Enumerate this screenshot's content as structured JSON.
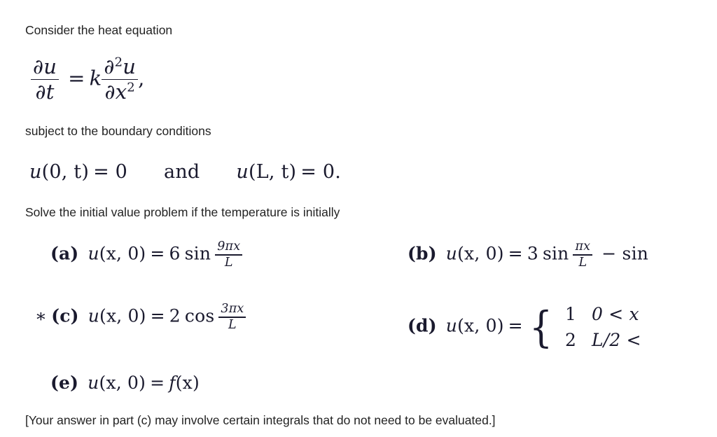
{
  "document": {
    "type": "math-textbook-problem",
    "background_color": "#ffffff",
    "prose_color": "#232323",
    "math_color": "#1a1a2e",
    "truncated_right_edge": true
  },
  "intro": {
    "line": "Consider the heat equation"
  },
  "pde": {
    "lhs_numerator": "∂u",
    "lhs_denominator": "∂t",
    "equals": "=",
    "coefficient": "k",
    "rhs_numerator_partial": "∂",
    "rhs_numerator_exponent": "2",
    "rhs_numerator_var": "u",
    "rhs_denominator_partial": "∂",
    "rhs_denominator_var": "x",
    "rhs_denominator_exponent": "2",
    "trailing_punctuation": ","
  },
  "boundary": {
    "lead_in": "subject to the boundary conditions",
    "left_condition": "u(0, t) = 0",
    "left_fn": "u",
    "left_args": "(0, t)",
    "left_eq": "= 0",
    "conjunction": "and",
    "right_fn": "u",
    "right_args": "(L, t)",
    "right_eq": "= 0."
  },
  "solve_line": "Solve the initial value problem if the temperature is initially",
  "parts": [
    {
      "id": "a",
      "label": "(a)",
      "starred": false,
      "star": "",
      "fn": "u",
      "args": "(x, 0)",
      "equals": "=",
      "coefficient": "6",
      "operator": "sin",
      "frac_num": "9πx",
      "frac_den": "L",
      "truncated": false,
      "tail": ""
    },
    {
      "id": "b",
      "label": "(b)",
      "starred": false,
      "star": "",
      "fn": "u",
      "args": "(x, 0)",
      "equals": "=",
      "coefficient": "3",
      "operator": "sin",
      "frac_num": "πx",
      "frac_den": "L",
      "truncated": true,
      "tail": "− sin"
    },
    {
      "id": "c",
      "label": "(c)",
      "starred": true,
      "star": "∗",
      "fn": "u",
      "args": "(x, 0)",
      "equals": "=",
      "coefficient": "2",
      "operator": "cos",
      "frac_num": "3πx",
      "frac_den": "L",
      "truncated": false,
      "tail": ""
    },
    {
      "id": "d",
      "label": "(d)",
      "starred": false,
      "star": "",
      "fn": "u",
      "args": "(x, 0)",
      "equals": "=",
      "piecewise": true,
      "brace": "{",
      "cases": [
        {
          "value": "1",
          "condition": "0 < x"
        },
        {
          "value": "2",
          "condition": "L/2 <"
        }
      ],
      "truncated": true
    },
    {
      "id": "e",
      "label": "(e)",
      "starred": false,
      "star": "",
      "fn": "u",
      "args": "(x, 0)",
      "equals": "=",
      "rhs_fn": "f",
      "rhs_args": "(x)",
      "truncated": false,
      "tail": ""
    }
  ],
  "footnote": "[Your answer in part (c) may involve certain integrals that do not need to be evaluated.]"
}
